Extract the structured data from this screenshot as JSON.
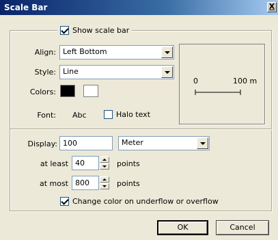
{
  "window": {
    "title": "Scale Bar",
    "close_glyph": "X"
  },
  "show_scale_bar": {
    "label": "Show scale bar",
    "checked": true
  },
  "align": {
    "label": "Align:",
    "value": "Left Bottom"
  },
  "style": {
    "label": "Style:",
    "value": "Line"
  },
  "colors": {
    "label": "Colors:",
    "primary": "#000000",
    "secondary": "#ffffff"
  },
  "font": {
    "label": "Font:",
    "sample": "Abc"
  },
  "halo": {
    "label": "Halo text",
    "checked": false
  },
  "preview": {
    "left_label": "0",
    "right_label": "100 m"
  },
  "display": {
    "label": "Display:",
    "value": "100",
    "unit": "Meter"
  },
  "at_least": {
    "label": "at least",
    "value": "40",
    "unit": "points"
  },
  "at_most": {
    "label": "at most",
    "value": "800",
    "unit": "points"
  },
  "change_color": {
    "label": "Change color on underflow or overflow",
    "checked": true
  },
  "buttons": {
    "ok": "OK",
    "cancel": "Cancel"
  }
}
